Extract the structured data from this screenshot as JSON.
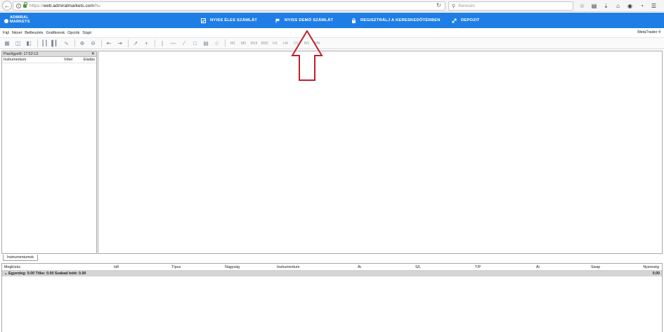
{
  "browser": {
    "url_protocol": "https://",
    "url_host": "web.admiralmarkets.com",
    "url_path": "/hu",
    "search_placeholder": "Keresés"
  },
  "site_header": {
    "logo_line1": "ADMIRAL",
    "logo_line2": "MARKETS",
    "nav": [
      {
        "label": "NYISS ÉLES SZÁMLÁT",
        "icon": "account-check-icon"
      },
      {
        "label": "NYISS DEMÓ SZÁMLÁT",
        "icon": "flag-icon"
      },
      {
        "label": "REGISZTRÁLJ A KERESKEDŐTÉRBEN",
        "icon": "lock-icon"
      },
      {
        "label": "DEPOZIT",
        "icon": "transfer-arrows-icon"
      }
    ],
    "bg_color": "#1f7ee5"
  },
  "menu": {
    "items": [
      "Fájl",
      "Nézet",
      "Beillesztés",
      "Grafikonok",
      "Opciók",
      "Súgó"
    ],
    "app_name": "MetaTrader 4"
  },
  "toolbar": {
    "timeframes": [
      "M1",
      "M5",
      "M15",
      "M30",
      "H1",
      "H4",
      "D1",
      "W1",
      "MN"
    ]
  },
  "market_watch": {
    "title": "Piacfigyelő: 17:52:13",
    "columns": [
      "Instrumentum",
      "Vétel",
      "Eladás"
    ],
    "tab_label": "Instrumentumok"
  },
  "terminal": {
    "columns": [
      "Megbízás",
      "Idő",
      "Típus",
      "Nagyság",
      "Instrumentum",
      "Ár",
      "S/L",
      "T/P",
      "Ár",
      "Swap",
      "Nyereség"
    ],
    "balance_text": "Egyenleg: 0.00  Tőke: 0.00  Szabad letét: 0.00",
    "balance_total": "0.00"
  },
  "annotation": {
    "arrow_color": "#c0202a"
  }
}
